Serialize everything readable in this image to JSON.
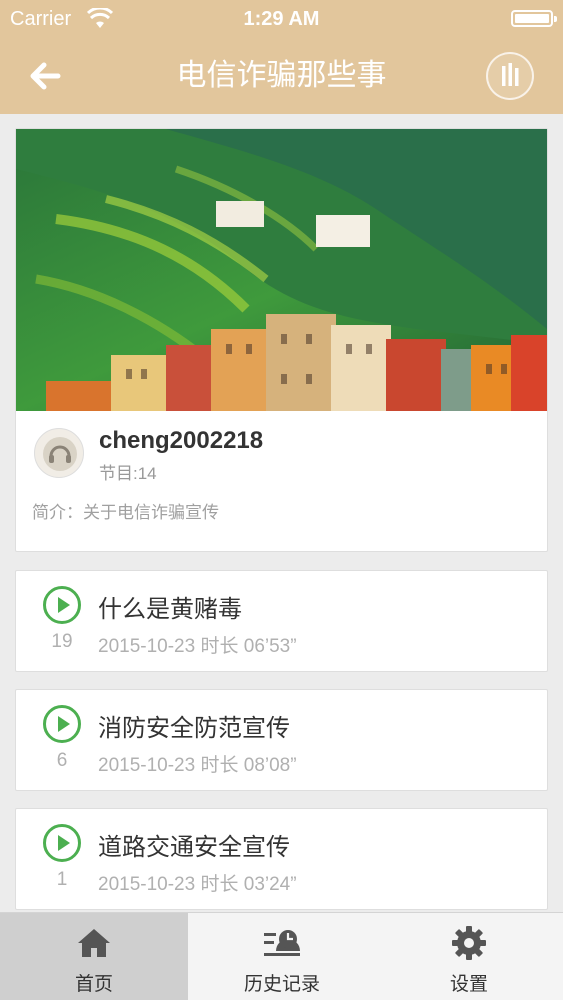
{
  "status_bar": {
    "carrier": "Carrier",
    "time": "1:29 AM"
  },
  "header": {
    "title": "电信诈骗那些事"
  },
  "profile": {
    "username": "cheng2002218",
    "program_count": "节目:14",
    "intro": "简介：关于电信诈骗宣传"
  },
  "tracks": [
    {
      "title": "什么是黄赌毒",
      "number": "19",
      "meta": "2015-10-23  时长 06’53”"
    },
    {
      "title": "消防安全防范宣传",
      "number": "6",
      "meta": "2015-10-23  时长 08’08”"
    },
    {
      "title": "道路交通安全宣传",
      "number": "1",
      "meta": "2015-10-23  时长 03’24”"
    }
  ],
  "tabs": [
    {
      "label": "首页",
      "icon": "home-icon",
      "active": true
    },
    {
      "label": "历史记录",
      "icon": "history-icon",
      "active": false
    },
    {
      "label": "设置",
      "icon": "gear-icon",
      "active": false
    }
  ],
  "colors": {
    "header": "#e2c69c",
    "accent_green": "#4caf50",
    "tab_active": "#cfcfcf"
  }
}
